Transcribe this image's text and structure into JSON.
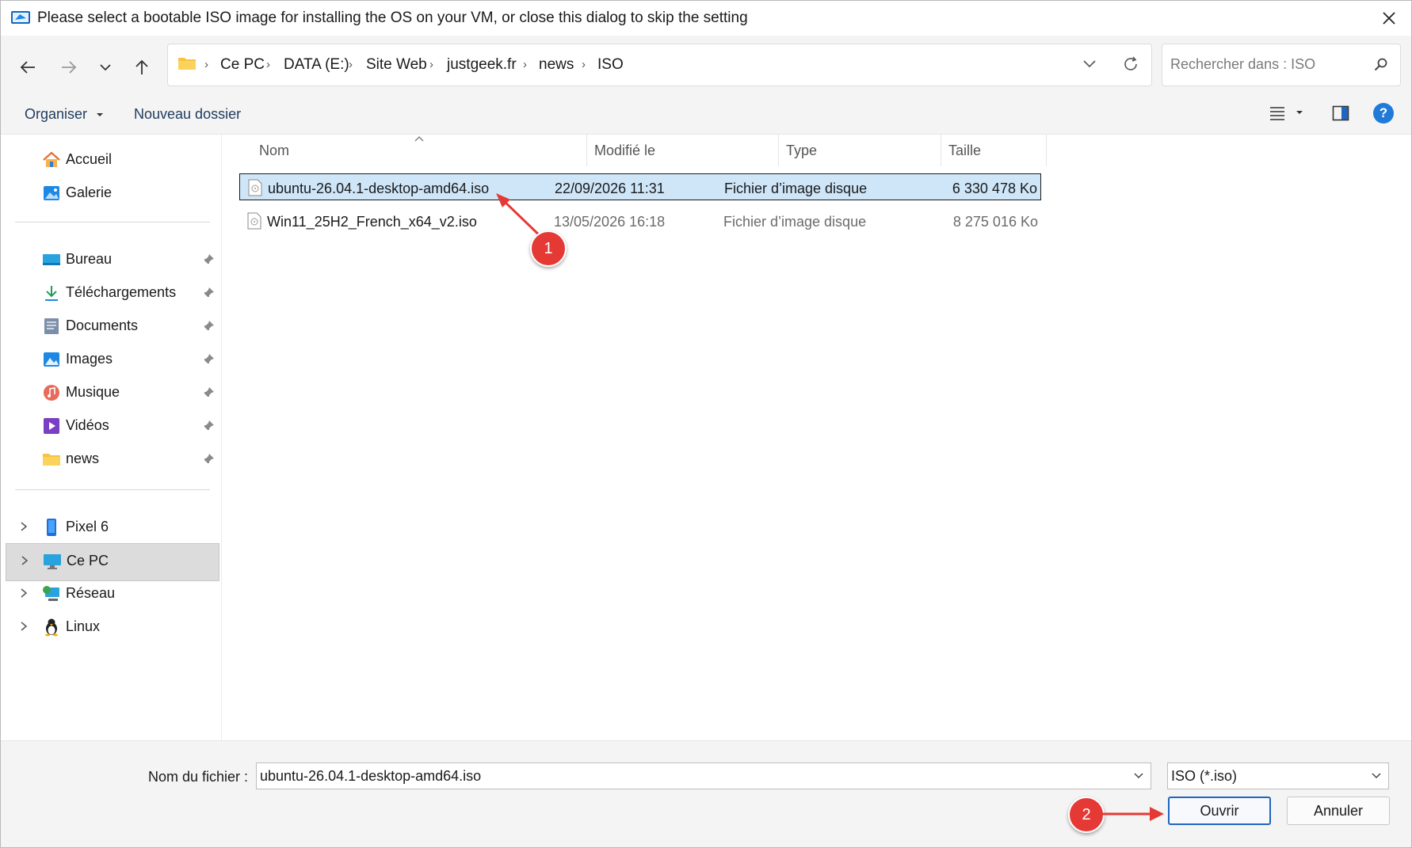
{
  "window": {
    "title": "Please select a bootable ISO image for installing the OS on your VM, or close this dialog to skip the setting"
  },
  "address_bar": {
    "crumbs": [
      "Ce PC",
      "DATA (E:)",
      "Site Web",
      "justgeek.fr",
      "news",
      "ISO"
    ]
  },
  "search": {
    "placeholder": "Rechercher dans : ISO"
  },
  "toolbar": {
    "organize_label": "Organiser",
    "new_folder_label": "Nouveau dossier",
    "help_label": "?"
  },
  "sidebar": {
    "quick": [
      {
        "label": "Accueil",
        "icon": "home-icon"
      },
      {
        "label": "Galerie",
        "icon": "gallery-icon"
      }
    ],
    "pinned": [
      {
        "label": "Bureau",
        "icon": "desktop-icon"
      },
      {
        "label": "Téléchargements",
        "icon": "downloads-icon"
      },
      {
        "label": "Documents",
        "icon": "documents-icon"
      },
      {
        "label": "Images",
        "icon": "pictures-icon"
      },
      {
        "label": "Musique",
        "icon": "music-icon"
      },
      {
        "label": "Vidéos",
        "icon": "videos-icon"
      },
      {
        "label": "news",
        "icon": "folder-icon"
      }
    ],
    "devices": [
      {
        "label": "Pixel 6",
        "icon": "phone-icon"
      },
      {
        "label": "Ce PC",
        "icon": "computer-icon",
        "selected": true
      },
      {
        "label": "Réseau",
        "icon": "network-icon"
      },
      {
        "label": "Linux",
        "icon": "linux-icon"
      }
    ]
  },
  "file_list": {
    "columns": [
      "Nom",
      "Modifié le",
      "Type",
      "Taille"
    ],
    "rows": [
      {
        "name": "ubuntu-26.04.1-desktop-amd64.iso",
        "modified": "22/09/2026 11:31",
        "type": "Fichier d’image disque",
        "size": "6 330 478 Ko",
        "selected": true
      },
      {
        "name": "Win11_25H2_French_x64_v2.iso",
        "modified": "13/05/2026 16:18",
        "type": "Fichier d’image disque",
        "size": "8 275 016 Ko",
        "selected": false
      }
    ]
  },
  "bottom": {
    "filename_label": "Nom du fichier :",
    "filename_value": "ubuntu-26.04.1-desktop-amd64.iso",
    "filter_value": "ISO (*.iso)",
    "open_label": "Ouvrir",
    "cancel_label": "Annuler"
  },
  "annotations": {
    "badge_1": "1",
    "badge_2": "2",
    "color": "#e53935"
  },
  "colors": {
    "accent": "#1f66c1",
    "selection": "#cfe6f9",
    "folder": "#f6c343"
  }
}
